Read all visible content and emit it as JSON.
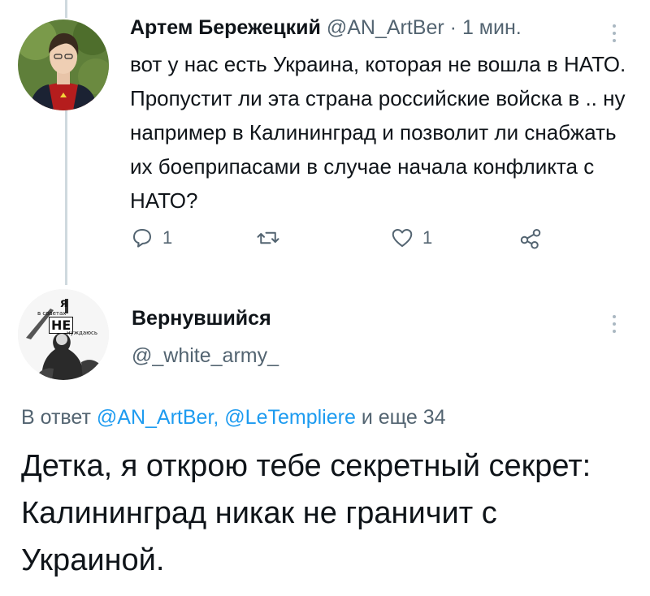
{
  "tweet": {
    "author_name": "Артем Бережецкий",
    "author_handle": "@AN_ArtBer",
    "separator": "·",
    "time": "1 мин.",
    "text": "вот у нас есть Украина, которая не вошла в НАТО. Пропустит ли эта страна российские войска в .. ну например в Калининград и позволит ли снабжать их боеприпасами в случае начала конфликта с НАТО?",
    "reply_count": "1",
    "like_count": "1"
  },
  "reply": {
    "author_name": "Вернувшийся",
    "author_handle": "@_white_army_",
    "avatar_text": {
      "top": "я",
      "left": "в советах",
      "mid": "НЕ",
      "bottom": "нуждаюсь"
    },
    "reply_prefix": "В ответ",
    "reply_mention_1": "@AN_ArtBer,",
    "reply_mention_2": "@LeTempliere",
    "reply_suffix": "и еще 34",
    "text": "Детка, я открою тебе секретный секрет: Калининград никак не граничит с Украиной."
  },
  "colors": {
    "accent": "#1d9bf0",
    "muted": "#536471",
    "line": "#cfd9de"
  }
}
